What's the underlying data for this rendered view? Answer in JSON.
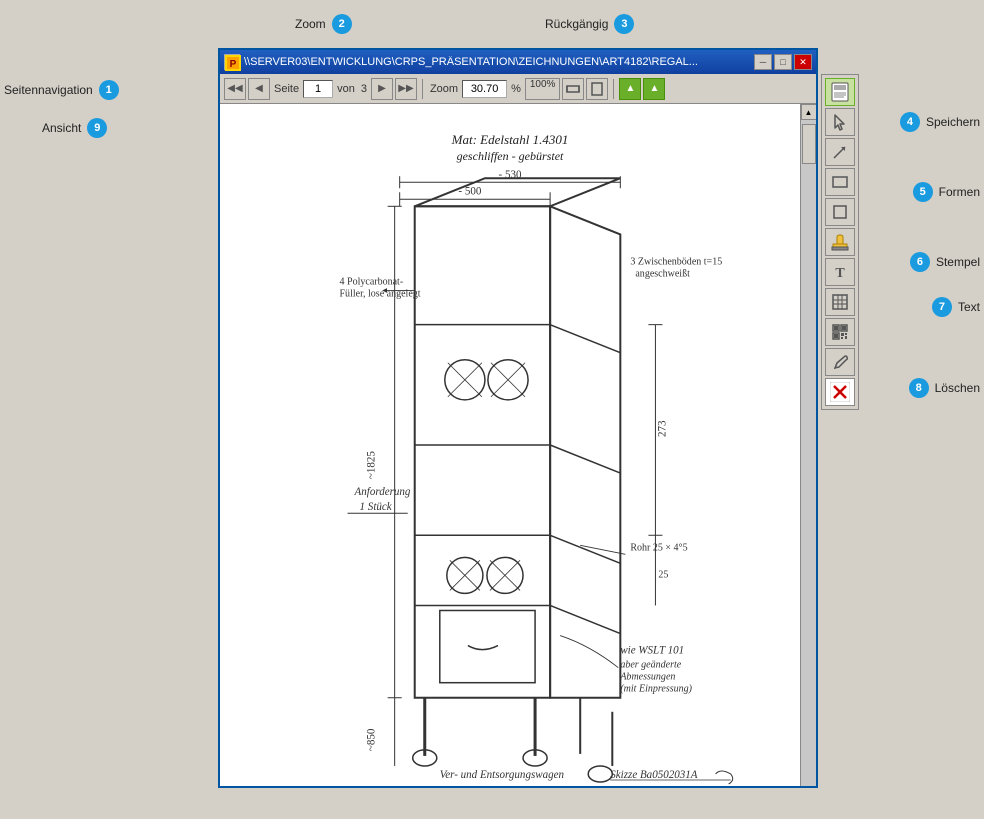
{
  "labels": {
    "zoom": "Zoom",
    "rueckgaengig": "Rückgängig",
    "seitennavigation": "Seitennavigation",
    "ansicht": "Ansicht",
    "speichern": "Speichern",
    "formen": "Formen",
    "stempel": "Stempel",
    "text": "Text",
    "loeschen": "Löschen"
  },
  "badges": {
    "zoom_num": "2",
    "rueckgaengig_num": "3",
    "seitennavigation_num": "1",
    "ansicht_num": "9",
    "speichern_num": "4",
    "formen_num": "5",
    "stempel_num": "6",
    "text_num": "7",
    "loeschen_num": "8"
  },
  "titlebar": {
    "title": "\\\\SERVER03\\ENTWICKLUNG\\CRPS_PRÄSENTATION\\ZEICHNUNGEN\\ART4182\\REGAL..."
  },
  "toolbar": {
    "page_value": "1",
    "page_label": "von",
    "page_total": "3",
    "zoom_label": "Zoom",
    "zoom_value": "30.70",
    "zoom_percent": "%",
    "zoom_100": "100%"
  },
  "nav_buttons": {
    "first": "◀◀",
    "prev": "◀",
    "next": "▶",
    "last": "▶▶"
  }
}
